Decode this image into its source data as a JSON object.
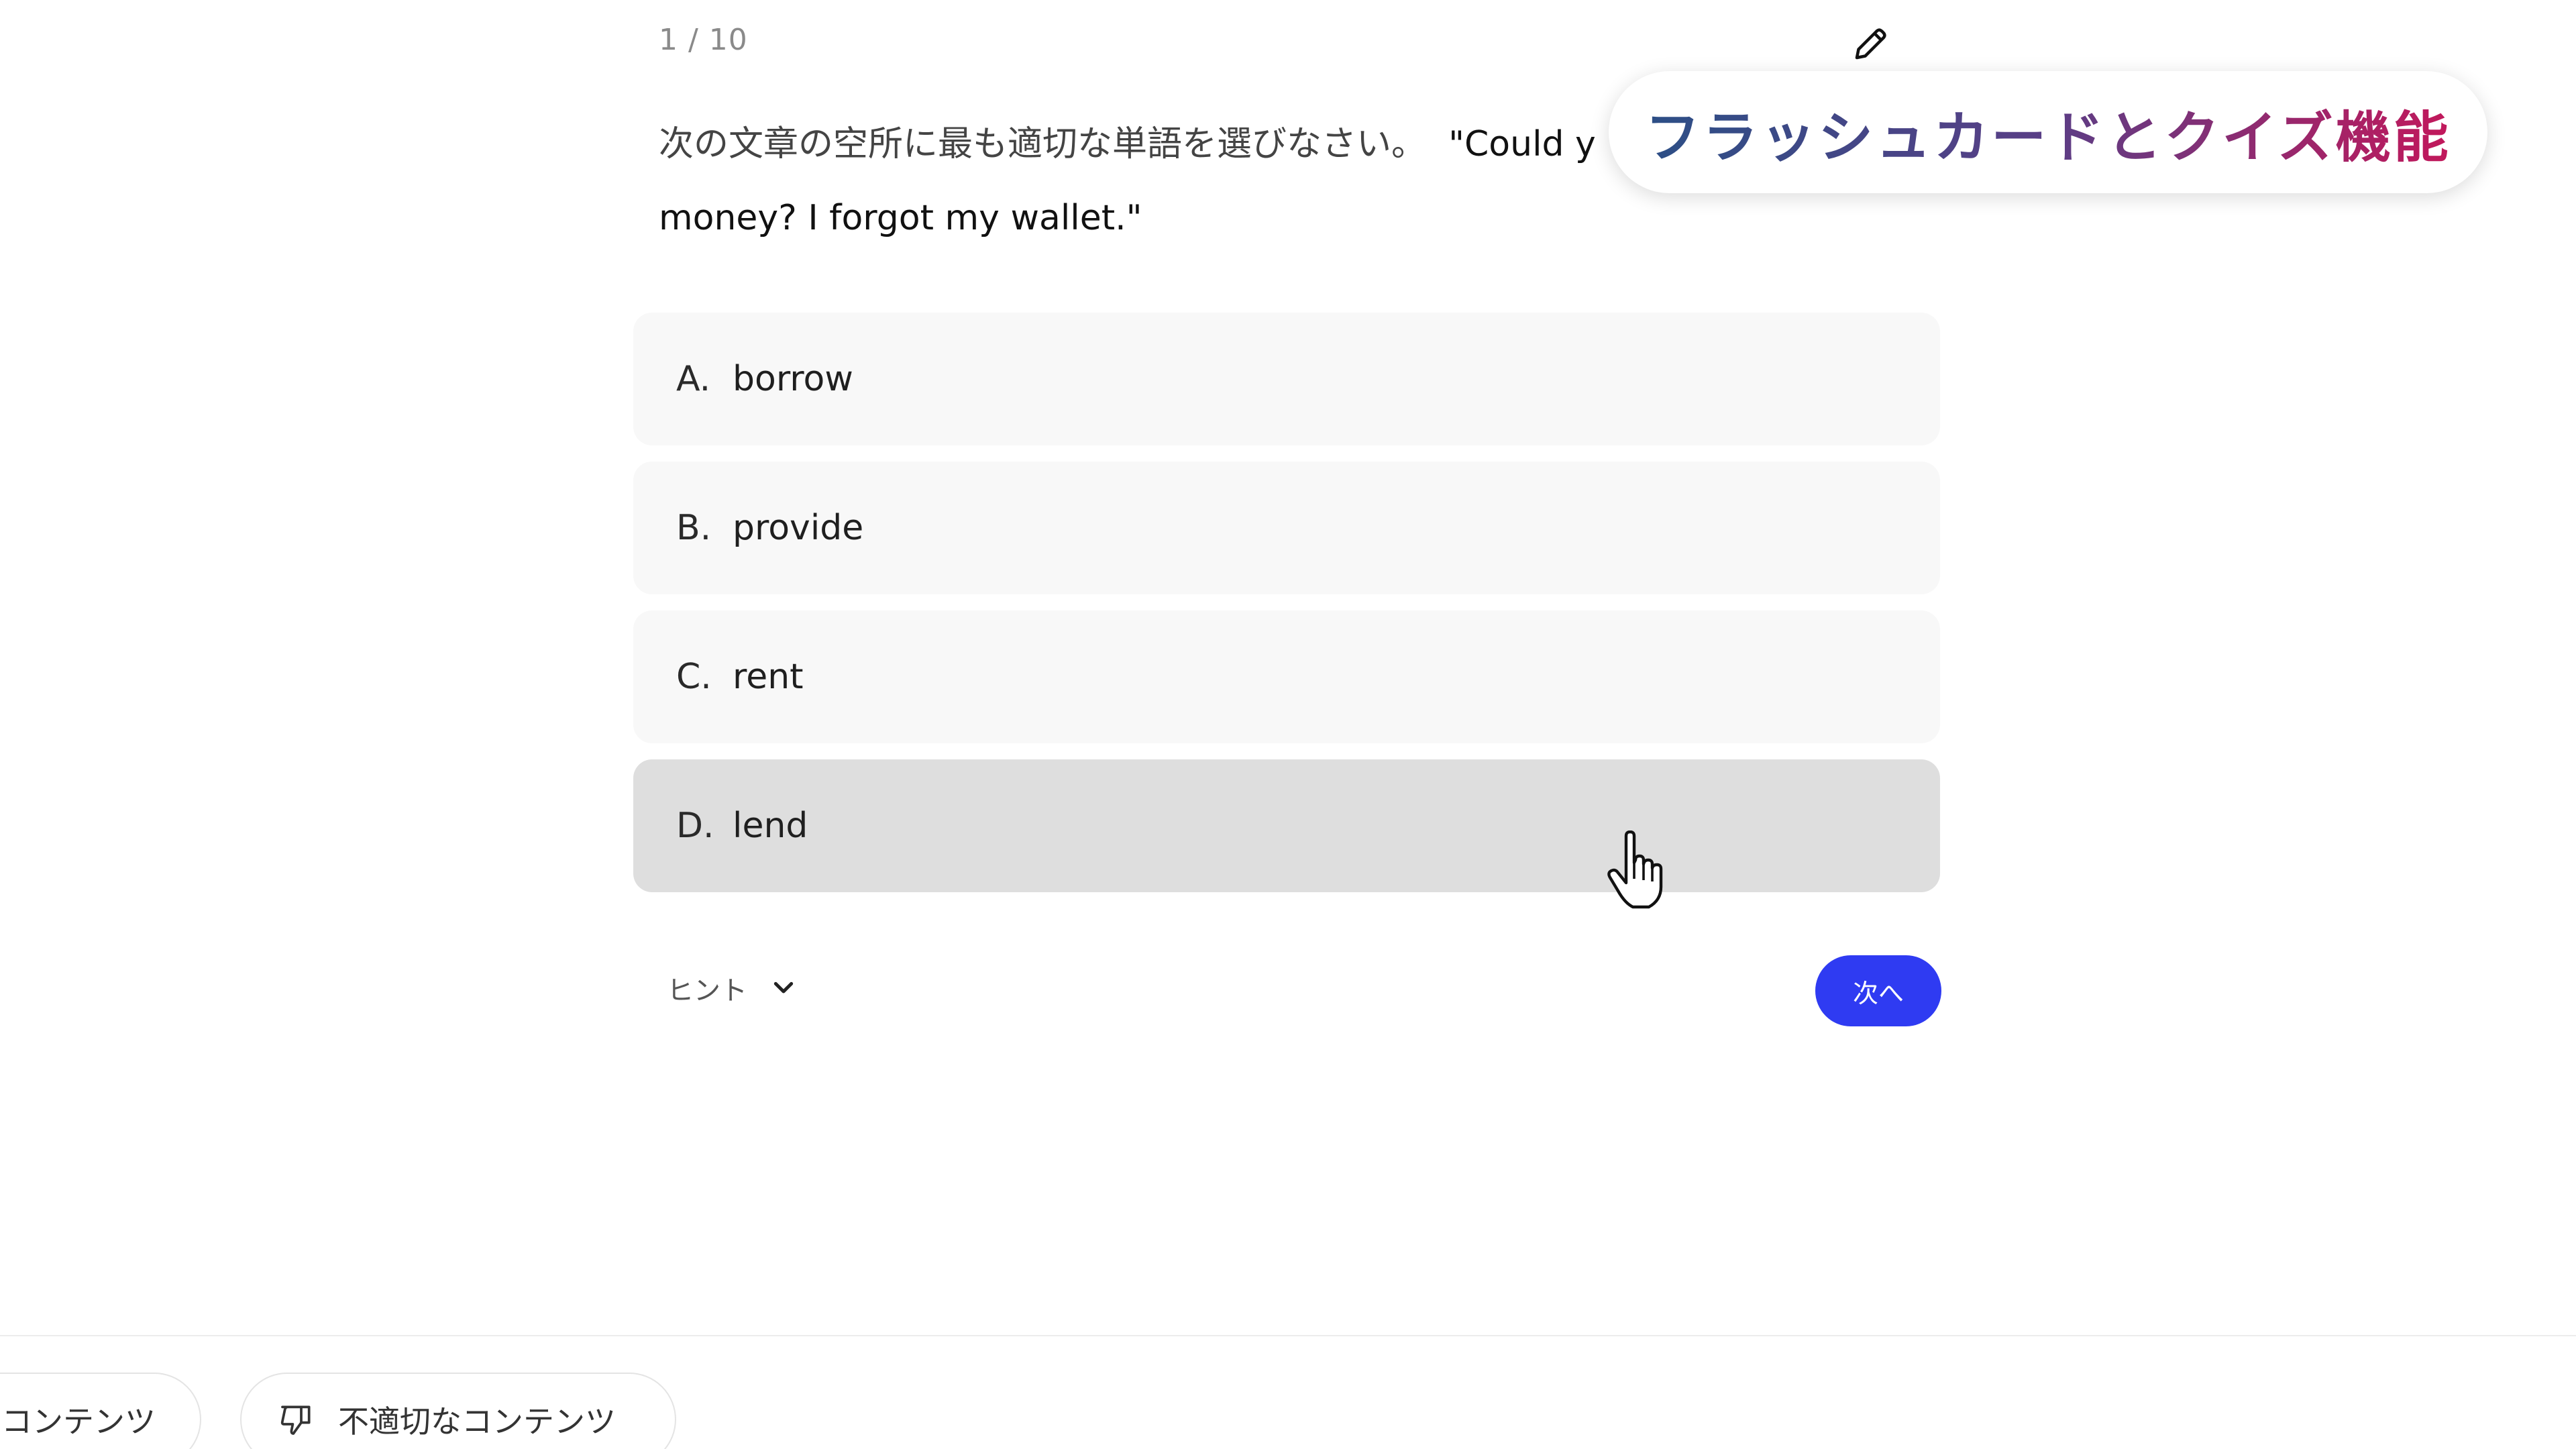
{
  "quiz": {
    "counter": "1 / 10",
    "question_ja": "次の文章の空所に最も適切な単語を選びなさい。",
    "question_en_line1": "\"Could y",
    "question_en_line2": "money? I forgot my wallet.\"",
    "options": [
      {
        "letter": "A.",
        "text": "borrow"
      },
      {
        "letter": "B.",
        "text": "provide"
      },
      {
        "letter": "C.",
        "text": "rent"
      },
      {
        "letter": "D.",
        "text": "lend"
      }
    ],
    "hovered_option": "D",
    "hint_label": "ヒント",
    "next_label": "次へ"
  },
  "footer": {
    "chip_left_label": "コンテンツ",
    "chip_right_label": "不適切なコンテンツ"
  },
  "overlay": {
    "caption": "フラッシュカードとクイズ機能"
  },
  "icons": {
    "pencil": "pencil-icon",
    "chevron": "chevron-down-icon",
    "thumbs_down": "thumbs-down-icon",
    "cursor": "hand-pointer-cursor"
  },
  "colors": {
    "next_button": "#2f3bf2",
    "option_bg": "#f8f8f8",
    "option_hover_bg": "#dedede",
    "caption_gradient_start": "#2c4f86",
    "caption_gradient_end": "#c2185b"
  }
}
